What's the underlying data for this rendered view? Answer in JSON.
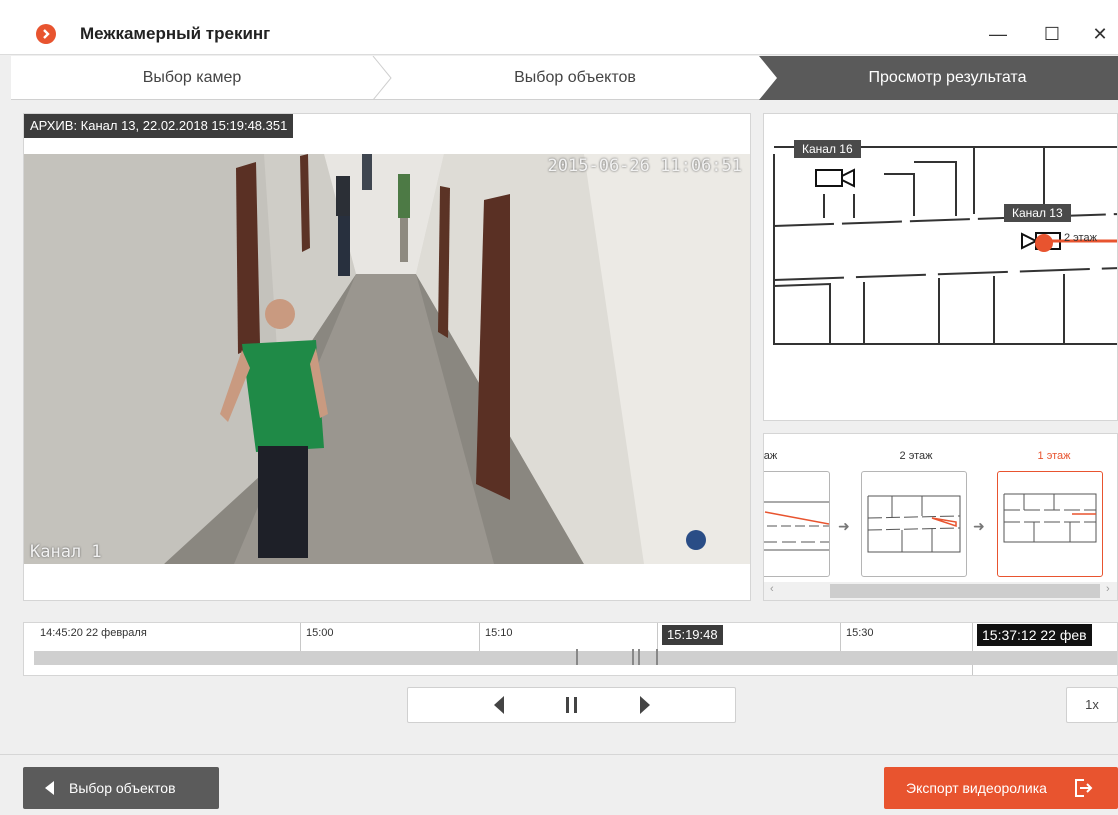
{
  "window": {
    "title": "Межкамерный трекинг",
    "controls": {
      "minimize": "—",
      "maximize": "☐",
      "close": "✕"
    }
  },
  "steps": [
    {
      "label": "Выбор камер",
      "state": "done"
    },
    {
      "label": "Выбор объектов",
      "state": "done"
    },
    {
      "label": "Просмотр результата",
      "state": "active"
    }
  ],
  "video": {
    "archive_label": "АРХИВ: Канал 13, 22.02.2018 15:19:48.351",
    "timestamp_overlay": "2015-06-26 11:06:51",
    "channel_overlay": "Канал 1"
  },
  "map": {
    "cameras": [
      {
        "label": "Канал 16"
      },
      {
        "label": "Канал 13",
        "floor_text": "2 этаж"
      }
    ]
  },
  "floors": {
    "items": [
      {
        "label": "таж",
        "active": false
      },
      {
        "label": "2 этаж",
        "active": false
      },
      {
        "label": "1 этаж",
        "active": true
      }
    ],
    "scroll_left_icon": "chevron-left-icon",
    "scroll_right_icon": "chevron-right-icon"
  },
  "timeline": {
    "start_label": "14:45:20 22 февраля",
    "ticks": [
      "15:00",
      "15:10",
      "15:30"
    ],
    "current_label": "15:19:48",
    "end_label": "15:37:12 22 фев"
  },
  "playback": {
    "prev_icon": "prev-icon",
    "pause_icon": "pause-icon",
    "next_icon": "next-icon",
    "speed": "1x"
  },
  "footer": {
    "back_label": "Выбор объектов",
    "export_label": "Экспорт видеоролика"
  },
  "colors": {
    "accent": "#e8542f",
    "dark_button": "#5b5b5b",
    "active_step_bg": "#5a5a5a"
  }
}
